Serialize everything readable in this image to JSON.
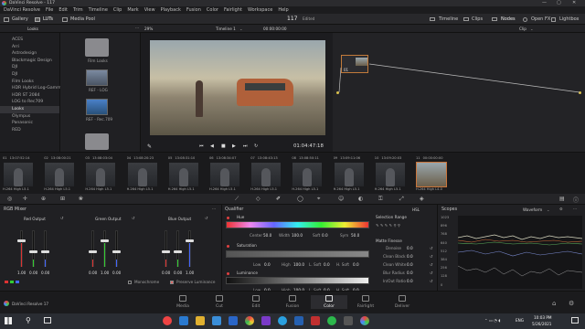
{
  "app": {
    "title": "DaVinci Resolve - 117"
  },
  "menu": [
    "DaVinci Resolve",
    "File",
    "Edit",
    "Trim",
    "Timeline",
    "Clip",
    "Mark",
    "View",
    "Playback",
    "Fusion",
    "Color",
    "Fairlight",
    "Workspace",
    "Help"
  ],
  "toolbar": {
    "left": [
      "Gallery",
      "LUTs",
      "Media Pool"
    ],
    "project_num": "117",
    "project_state": "Edited",
    "right": [
      "Timeline",
      "Clips",
      "Nodes",
      "Open FX",
      "Lightbox"
    ]
  },
  "lutsbar": {
    "panel_title": "Looks",
    "zoom": "29%",
    "timeline": "Timeline 1",
    "timecode": "00:00:00:00",
    "node_mode": "Clip"
  },
  "luts_tree": [
    "ACES",
    "Arri",
    "Astrodesign",
    "Blackmagic Design",
    "DJI",
    "DJI",
    "Film Looks",
    "HDR Hybrid Log-Gamma",
    "HDR ST 2084",
    "LOG to Rec709",
    "Looks",
    "Olympus",
    "Panasonic",
    "RED"
  ],
  "luts_selected": 10,
  "thumbs": [
    {
      "label": "Film Looks"
    },
    {
      "label": "REF - LOG"
    },
    {
      "label": "REF - Rec.709"
    },
    {
      "label": ""
    }
  ],
  "viewer": {
    "timecode": "01:04:47:18"
  },
  "node": {
    "label": "01"
  },
  "clips": [
    {
      "num": "01",
      "tc": "13:07:52:14",
      "codec": "H.264 High L5.1"
    },
    {
      "num": "02",
      "tc": "13:08:00:21",
      "codec": "H.264 High L5.1"
    },
    {
      "num": "03",
      "tc": "13:08:03:04",
      "codec": "H.264 High L5.1"
    },
    {
      "num": "04",
      "tc": "13:08:20:23",
      "codec": "H.264 High L5.1"
    },
    {
      "num": "05",
      "tc": "13:08:31:10",
      "codec": "H.264 High L5.1"
    },
    {
      "num": "06",
      "tc": "13:08:34:07",
      "codec": "H.264 High L5.1"
    },
    {
      "num": "07",
      "tc": "13:08:43:13",
      "codec": "H.264 High L5.1"
    },
    {
      "num": "08",
      "tc": "13:08:50:11",
      "codec": "H.264 High L5.1"
    },
    {
      "num": "09",
      "tc": "13:09:11:06",
      "codec": "H.264 High L5.1"
    },
    {
      "num": "10",
      "tc": "13:09:20:03",
      "codec": "H.264 High L5.1"
    },
    {
      "num": "11",
      "tc": "00:00:00:00",
      "codec": "H.264 High L4.0"
    }
  ],
  "rgbmixer": {
    "title": "RGB Mixer",
    "groups": [
      {
        "label": "Red Output",
        "values": [
          "1.00",
          "0.00",
          "0.00"
        ]
      },
      {
        "label": "Green Output",
        "values": [
          "0.00",
          "1.00",
          "0.00"
        ]
      },
      {
        "label": "Blue Output",
        "values": [
          "0.00",
          "0.00",
          "1.00"
        ]
      }
    ],
    "monochrome": "Monochrome",
    "preserve": "Preserve Luminance"
  },
  "qualifier": {
    "title": "Qualifier",
    "hue": {
      "label": "Hue",
      "center_label": "Center",
      "center": "50.0",
      "width_label": "Width",
      "width": "100.0",
      "soft_label": "Soft",
      "soft": "0.0",
      "sym_label": "Sym",
      "sym": "50.0"
    },
    "sat": {
      "label": "Saturation",
      "low_label": "Low",
      "low": "0.0",
      "high_label": "High",
      "high": "100.0",
      "lsoft_label": "L. Soft",
      "lsoft": "0.0",
      "hsoft_label": "H. Soft",
      "hsoft": "0.0"
    },
    "lum": {
      "label": "Luminance",
      "low_label": "Low",
      "low": "0.0",
      "high_label": "High",
      "high": "100.0",
      "lsoft_label": "L. Soft",
      "lsoft": "0.0",
      "hsoft_label": "H. Soft",
      "hsoft": "0.0"
    },
    "selection_range": "Selection Range",
    "mode": "HSL",
    "matte_finesse": "Matte Finesse",
    "mf_rows": [
      {
        "label": "Denoise",
        "value": "0.0"
      },
      {
        "label": "Clean Black",
        "value": "0.0"
      },
      {
        "label": "Clean White",
        "value": "0.0"
      },
      {
        "label": "Blur Radius",
        "value": "0.0"
      },
      {
        "label": "In/Out Ratio",
        "value": "0.0"
      }
    ]
  },
  "scopes": {
    "title": "Scopes",
    "mode": "Waveform",
    "ticks": [
      "1023",
      "896",
      "768",
      "640",
      "512",
      "384",
      "256",
      "128",
      "0"
    ]
  },
  "pages": [
    "Media",
    "Cut",
    "Edit",
    "Fusion",
    "Color",
    "Fairlight",
    "Deliver"
  ],
  "active_page": "Color",
  "product": "DaVinci Resolve 17",
  "taskbar": {
    "lang": "ENG",
    "time": "10:03 PM",
    "date": "5/26/2021"
  }
}
